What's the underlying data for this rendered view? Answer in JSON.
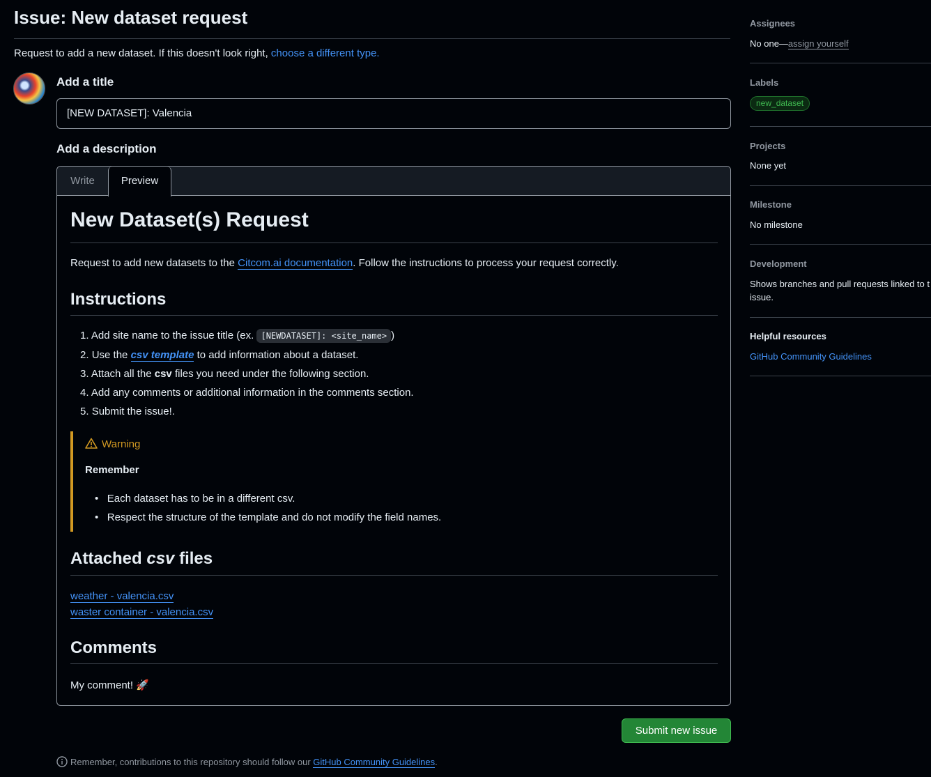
{
  "page": {
    "title": "Issue: New dataset request",
    "subtitle": "Request to add a new dataset. If this doesn't look right, ",
    "subtitle_link": "choose a different type."
  },
  "form": {
    "title_label": "Add a title",
    "title_value": "[NEW DATASET]: Valencia",
    "description_label": "Add a description",
    "tabs": [
      "Write",
      "Preview"
    ],
    "active_tab": "Preview"
  },
  "preview": {
    "h1": "New Dataset(s) Request",
    "intro_pre": "Request to add new datasets to the ",
    "intro_link": "Citcom.ai documentation",
    "intro_post": ". Follow the instructions to process your request correctly.",
    "instructions_heading": "Instructions",
    "steps": [
      {
        "num": "1.",
        "pre": "Add site name to the issue title (ex. ",
        "code": "[NEWDATASET]: <site_name>",
        "post": ")"
      },
      {
        "num": "2.",
        "pre": "Use the ",
        "link": "csv template",
        "post": " to add information about a dataset."
      },
      {
        "num": "3.",
        "pre": "Attach all the ",
        "bold": "csv",
        "post": " files you need under the following section."
      },
      {
        "num": "4.",
        "text": "Add any comments or additional information in the comments section."
      },
      {
        "num": "5.",
        "text": "Submit the issue!."
      }
    ],
    "warning": {
      "title": "Warning",
      "heading": "Remember",
      "bullets": [
        "Each dataset has to be in a different csv.",
        "Respect the structure of the template and do not modify the field names."
      ],
      "color": "#d29922"
    },
    "attached_heading_pre": "Attached ",
    "attached_heading_em": "csv",
    "attached_heading_post": " files",
    "files": [
      "weather - valencia.csv",
      "waster container - valencia.csv"
    ],
    "comments_heading": "Comments",
    "comment": "My comment! 🚀"
  },
  "submit_label": "Submit new issue",
  "footer": {
    "text": "Remember, contributions to this repository should follow our ",
    "link": "GitHub Community Guidelines",
    "end": "."
  },
  "sidebar": {
    "assignees": {
      "heading": "Assignees",
      "text": "No one—",
      "link": "assign yourself"
    },
    "labels": {
      "heading": "Labels",
      "label": "new_dataset",
      "color": "#2ea043"
    },
    "projects": {
      "heading": "Projects",
      "text": "None yet"
    },
    "milestone": {
      "heading": "Milestone",
      "text": "No milestone"
    },
    "development": {
      "heading": "Development",
      "text1": "Shows branches and pull requests linked to t",
      "text2": "issue."
    },
    "resources": {
      "heading": "Helpful resources",
      "link": "GitHub Community Guidelines"
    }
  }
}
